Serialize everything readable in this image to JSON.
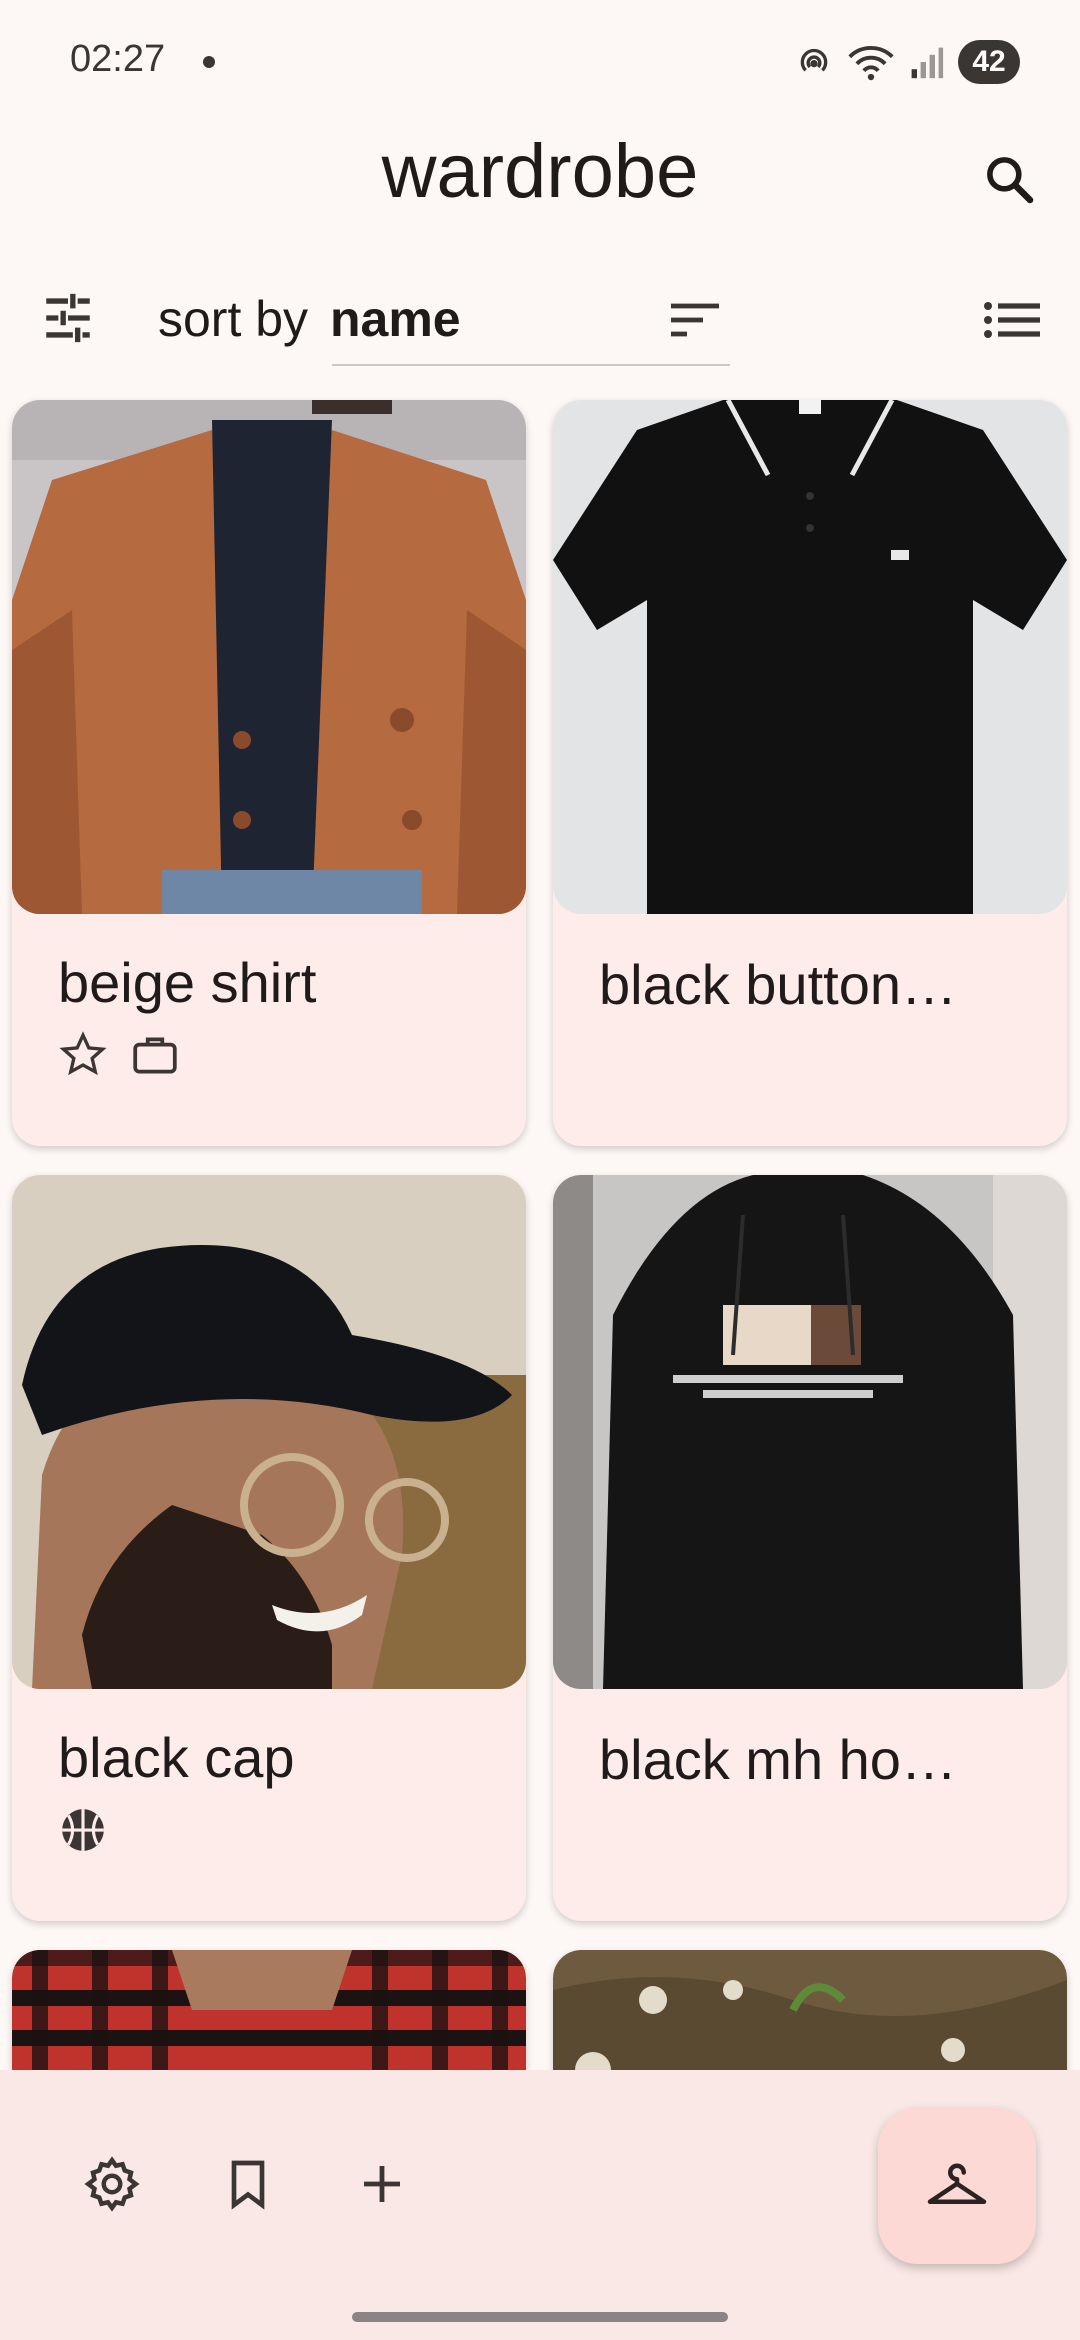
{
  "status_bar": {
    "time": "02:27",
    "battery": "42"
  },
  "header": {
    "title": "wardrobe"
  },
  "sort": {
    "prefix": "sort by",
    "value": "name"
  },
  "items": [
    {
      "name": "beige shirt",
      "tags": [
        "star-outline-icon",
        "briefcase-icon"
      ]
    },
    {
      "name": "black button…",
      "tags": []
    },
    {
      "name": "black cap",
      "tags": [
        "sports-ball-icon"
      ]
    },
    {
      "name": "black mh ho…",
      "tags": []
    }
  ],
  "colors": {
    "background": "#fdf8f5",
    "card": "#fdecea",
    "bottom_bar": "#f9e8e6",
    "fab": "#fcd9d5",
    "accent_text": "#1f1b1a"
  }
}
